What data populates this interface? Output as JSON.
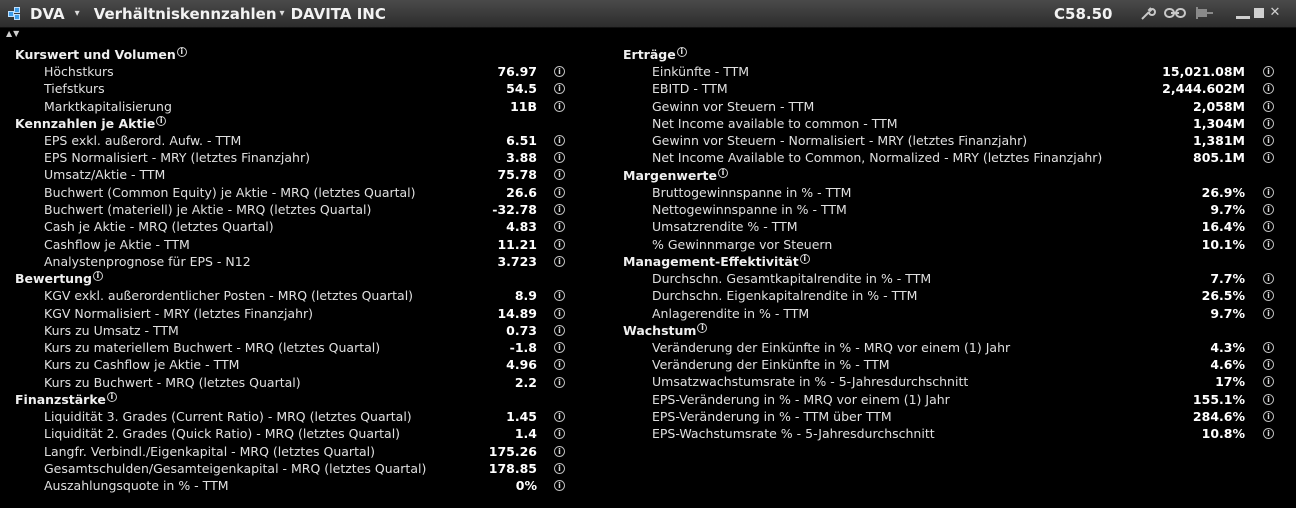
{
  "title_bar": {
    "symbol": "DVA",
    "symbol_caret": "▾",
    "view_title": "Verhältniskennzahlen",
    "view_caret": "▾",
    "company": "DAVITA INC",
    "price": "C58.50"
  },
  "sort_arrows": "▲▼",
  "info_glyph": "i",
  "left_sections": [
    {
      "title": "Kurswert und Volumen",
      "rows": [
        {
          "label": "Höchstkurs",
          "value": "76.97"
        },
        {
          "label": "Tiefstkurs",
          "value": "54.5"
        },
        {
          "label": "Marktkapitalisierung",
          "value": "11B"
        }
      ]
    },
    {
      "title": "Kennzahlen je Aktie",
      "rows": [
        {
          "label": "EPS exkl. außerord. Aufw. - TTM",
          "value": "6.51"
        },
        {
          "label": "EPS Normalisiert - MRY (letztes Finanzjahr)",
          "value": "3.88"
        },
        {
          "label": "Umsatz/Aktie - TTM",
          "value": "75.78"
        },
        {
          "label": "Buchwert (Common Equity) je Aktie - MRQ (letztes Quartal)",
          "value": "26.6"
        },
        {
          "label": "Buchwert (materiell) je Aktie - MRQ (letztes Quartal)",
          "value": "-32.78"
        },
        {
          "label": "Cash je Aktie - MRQ (letztes Quartal)",
          "value": "4.83"
        },
        {
          "label": "Cashflow je Aktie - TTM",
          "value": "11.21"
        },
        {
          "label": "Analystenprognose für EPS - N12",
          "value": "3.723"
        }
      ]
    },
    {
      "title": "Bewertung",
      "rows": [
        {
          "label": "KGV exkl. außerordentlicher Posten - MRQ (letztes Quartal)",
          "value": "8.9"
        },
        {
          "label": "KGV Normalisiert - MRY (letztes Finanzjahr)",
          "value": "14.89"
        },
        {
          "label": "Kurs zu Umsatz - TTM",
          "value": "0.73"
        },
        {
          "label": "Kurs zu materiellem Buchwert - MRQ (letztes Quartal)",
          "value": "-1.8"
        },
        {
          "label": "Kurs zu Cashflow je Aktie - TTM",
          "value": "4.96"
        },
        {
          "label": "Kurs zu Buchwert - MRQ (letztes Quartal)",
          "value": "2.2"
        }
      ]
    },
    {
      "title": "Finanzstärke",
      "rows": [
        {
          "label": "Liquidität 3. Grades (Current Ratio) - MRQ (letztes Quartal)",
          "value": "1.45"
        },
        {
          "label": "Liquidität 2. Grades (Quick Ratio) - MRQ (letztes Quartal)",
          "value": "1.4"
        },
        {
          "label": "Langfr. Verbindl./Eigenkapital - MRQ (letztes Quartal)",
          "value": "175.26"
        },
        {
          "label": "Gesamtschulden/Gesamteigenkapital - MRQ (letztes Quartal)",
          "value": "178.85"
        },
        {
          "label": "Auszahlungsquote in % - TTM",
          "value": "0%"
        }
      ]
    }
  ],
  "right_sections": [
    {
      "title": "Erträge",
      "rows": [
        {
          "label": "Einkünfte - TTM",
          "value": "15,021.08M"
        },
        {
          "label": "EBITD - TTM",
          "value": "2,444.602M"
        },
        {
          "label": "Gewinn vor Steuern - TTM",
          "value": "2,058M"
        },
        {
          "label": "Net Income available to common - TTM",
          "value": "1,304M"
        },
        {
          "label": "Gewinn vor Steuern - Normalisiert - MRY (letztes Finanzjahr)",
          "value": "1,381M"
        },
        {
          "label": "Net Income Available to Common, Normalized - MRY (letztes Finanzjahr)",
          "value": "805.1M"
        }
      ]
    },
    {
      "title": "Margenwerte",
      "rows": [
        {
          "label": "Bruttogewinnspanne in % - TTM",
          "value": "26.9%"
        },
        {
          "label": "Nettogewinnspanne in % - TTM",
          "value": "9.7%"
        },
        {
          "label": "Umsatzrendite % - TTM",
          "value": "16.4%"
        },
        {
          "label": "% Gewinnmarge vor Steuern",
          "value": "10.1%"
        }
      ]
    },
    {
      "title": "Management-Effektivität",
      "rows": [
        {
          "label": "Durchschn. Gesamtkapitalrendite in % - TTM",
          "value": "7.7%"
        },
        {
          "label": "Durchschn. Eigenkapitalrendite in % - TTM",
          "value": "26.5%"
        },
        {
          "label": "Anlagerendite in % - TTM",
          "value": "9.7%"
        }
      ]
    },
    {
      "title": "Wachstum",
      "rows": [
        {
          "label": "Veränderung der Einkünfte in % - MRQ vor einem (1) Jahr",
          "value": "4.3%"
        },
        {
          "label": "Veränderung der Einkünfte in % - TTM",
          "value": "4.6%"
        },
        {
          "label": "Umsatzwachstumsrate in % - 5-Jahresdurchschnitt",
          "value": "17%"
        },
        {
          "label": "EPS-Veränderung in % - MRQ vor einem (1) Jahr",
          "value": "155.1%"
        },
        {
          "label": "EPS-Veränderung in % - TTM über TTM",
          "value": "284.6%"
        },
        {
          "label": "EPS-Wachstumsrate % - 5-Jahresdurchschnitt",
          "value": "10.8%"
        }
      ]
    }
  ]
}
